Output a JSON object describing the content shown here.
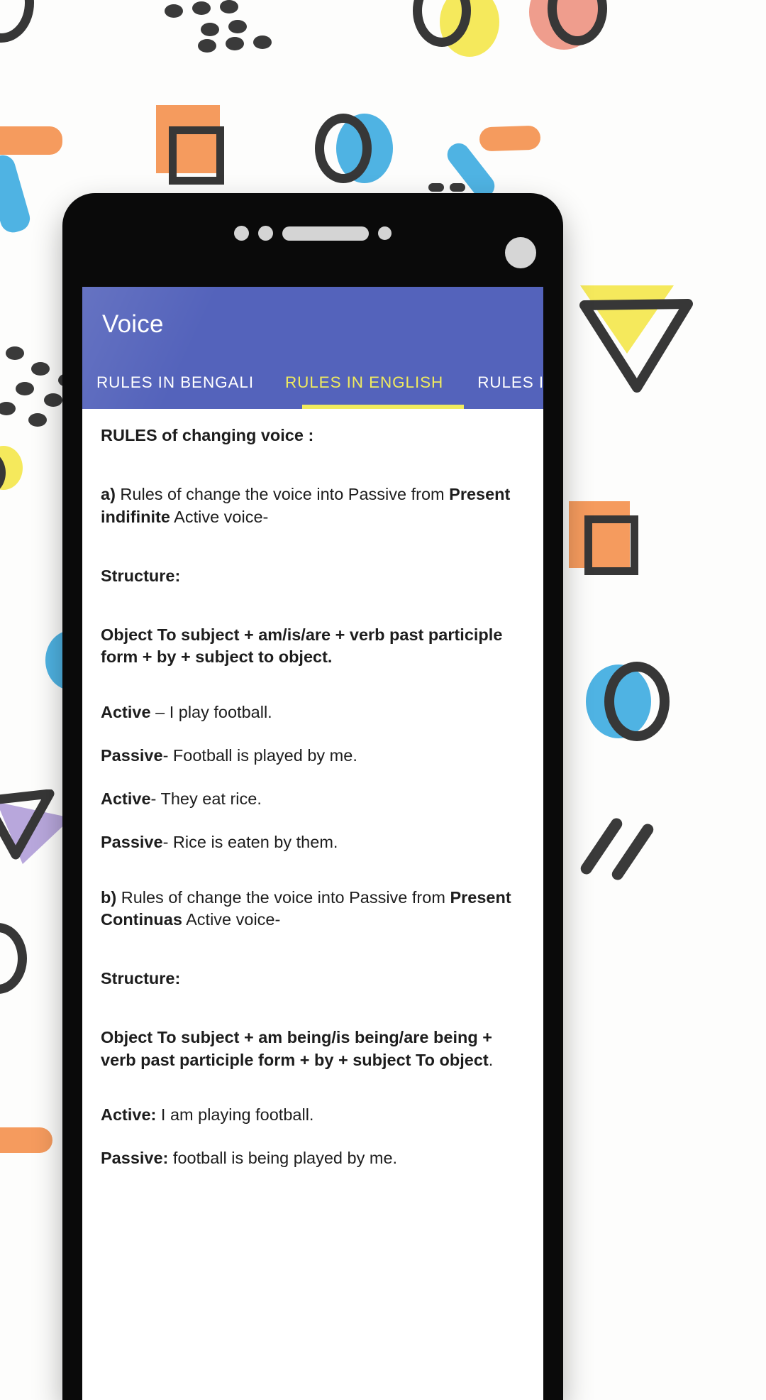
{
  "app": {
    "title": "Voice",
    "appbar_color": "#5463BB",
    "accent_color": "#F0EB5E",
    "tabs": [
      {
        "label": "RULES IN BENGALI",
        "active": false
      },
      {
        "label": "RULES IN ENGLISH",
        "active": true
      },
      {
        "label": "RULES IN HINDI",
        "active": false
      }
    ]
  },
  "content": {
    "heading": "RULES of changing voice :",
    "rule_a": {
      "marker": "a)",
      "text_1": " Rules of change the voice into Passive from ",
      "bold_1": "Present indifinite",
      "text_2": " Active voice-"
    },
    "structure_label_1": "Structure:",
    "structure_1": "Object To subject + am/is/are + verb past participle form + by + subject to object.",
    "examples_1": [
      {
        "label": "Active",
        "sep": " – ",
        "sentence": "I play football."
      },
      {
        "label": "Passive",
        "sep": "- ",
        "sentence": "Football is played by me."
      },
      {
        "label": "Active",
        "sep": "- ",
        "sentence": "They eat rice."
      },
      {
        "label": "Passive",
        "sep": "- ",
        "sentence": "Rice is eaten by them."
      }
    ],
    "rule_b": {
      "marker": "b)",
      "text_1": " Rules of change the voice into Passive from ",
      "bold_1": "Present Continuas",
      "text_2": " Active voice-"
    },
    "structure_label_2": "Structure:",
    "structure_2_bold": "Object To subject + am being/is being/are being + verb past participle form + by + subject To object",
    "structure_2_tail": ".",
    "examples_2": [
      {
        "label": "Active:",
        "sep": " ",
        "sentence": "I am playing football."
      },
      {
        "label": "Passive:",
        "sep": " ",
        "sentence": "football is being played by me."
      }
    ]
  },
  "decor": {
    "colors": {
      "dark": "#373737",
      "orange": "#F59B5E",
      "yellow": "#F5E95C",
      "salmon": "#EF9D8D",
      "blue": "#4FB3E3",
      "purple": "#B8A7DC"
    }
  }
}
